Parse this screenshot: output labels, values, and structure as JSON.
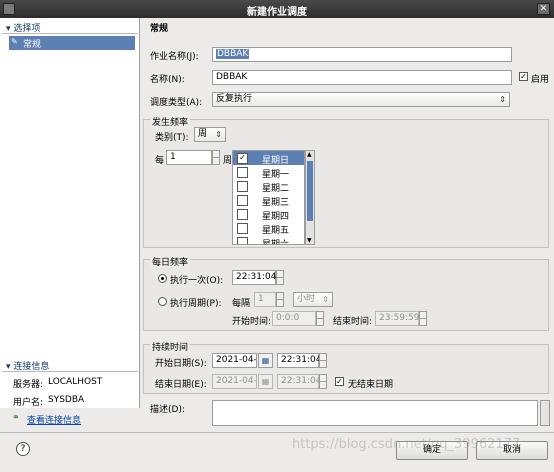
{
  "window": {
    "title": "新建作业调度"
  },
  "sidebar": {
    "header": "选择项",
    "items": [
      "常规"
    ],
    "connection": {
      "header": "连接信息",
      "server_label": "服务器:",
      "server": "LOCALHOST",
      "user_label": "用户名:",
      "user": "SYSDBA",
      "view_link": "查看连接信息"
    }
  },
  "main": {
    "section_title": "常规",
    "job_name": {
      "label": "作业名称(J):",
      "value": "DBBAK"
    },
    "name": {
      "label": "名称(N):",
      "value": "DBBAK"
    },
    "enabled": {
      "label": "启用",
      "checked": true
    },
    "schedule_type": {
      "label": "调度类型(A):",
      "value": "反复执行"
    },
    "frequency": {
      "title": "发生频率",
      "category_label": "类别(T):",
      "category_value": "周",
      "every_label": "每",
      "every_value": "1",
      "unit_label": "周",
      "days": [
        {
          "label": "星期日",
          "checked": true
        },
        {
          "label": "星期一",
          "checked": false
        },
        {
          "label": "星期二",
          "checked": false
        },
        {
          "label": "星期三",
          "checked": false
        },
        {
          "label": "星期四",
          "checked": false
        },
        {
          "label": "星期五",
          "checked": false
        },
        {
          "label": "星期六",
          "checked": false
        }
      ]
    },
    "daily": {
      "title": "每日频率",
      "once_label": "执行一次(O):",
      "once_time": "22:31:04",
      "period_label": "执行周期(P):",
      "every_label": "每隔",
      "every_value": "1",
      "unit_value": "小时",
      "start_label": "开始时间:",
      "start_time": "0:0:0",
      "end_label": "结束时间:",
      "end_time": "23:59:59"
    },
    "duration": {
      "title": "持续时间",
      "start_label": "开始日期(S):",
      "start_date": "2021-04-04",
      "start_time": "22:31:04",
      "end_label": "结束日期(E):",
      "end_date": "2021-04-05",
      "end_time": "22:31:04",
      "no_end_label": "无结束日期"
    },
    "description": {
      "label": "描述(D):",
      "value": ""
    }
  },
  "footer": {
    "ok": "确定",
    "cancel": "取消",
    "watermark": "https://blog.csdn.net/qq_39962177"
  }
}
